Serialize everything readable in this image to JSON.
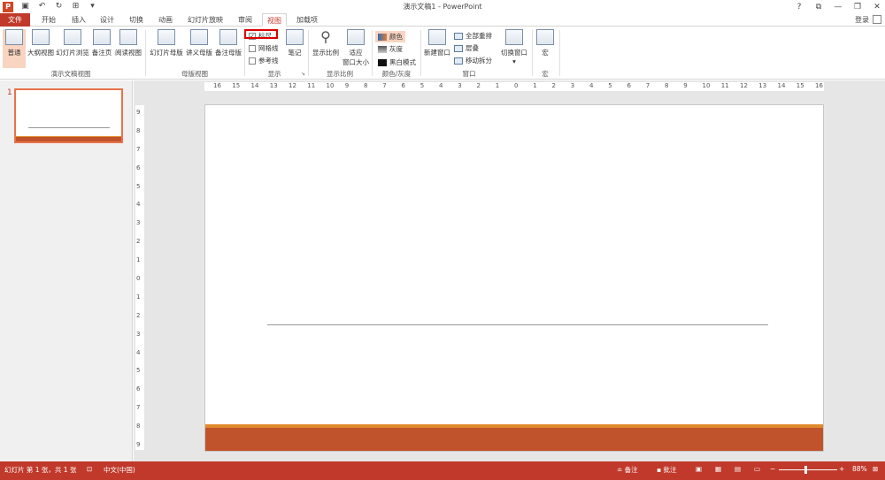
{
  "window": {
    "title": "演示文稿1 - PowerPoint",
    "logo": "P",
    "controls": [
      "?",
      "⧉",
      "—",
      "❐",
      "✕"
    ]
  },
  "quick_access": {
    "icons": [
      "save-icon",
      "undo-icon",
      "redo-icon",
      "start-from-beginning-icon",
      "customize-icon"
    ]
  },
  "tabs": [
    {
      "label": "文件"
    },
    {
      "label": "开始"
    },
    {
      "label": "插入"
    },
    {
      "label": "设计"
    },
    {
      "label": "切换"
    },
    {
      "label": "动画"
    },
    {
      "label": "幻灯片放映"
    },
    {
      "label": "审阅"
    },
    {
      "label": "视图"
    },
    {
      "label": "加载项"
    }
  ],
  "account": {
    "login": "登录"
  },
  "ribbon": {
    "groups": [
      {
        "label": "演示文稿视图",
        "buttons": [
          "普通",
          "大纲视图",
          "幻灯片浏览",
          "备注页",
          "阅读视图"
        ]
      },
      {
        "label": "母版视图",
        "buttons": [
          "幻灯片母版",
          "讲义母版",
          "备注母版"
        ]
      },
      {
        "label": "显示",
        "checkboxes": [
          "标尺",
          "网格线",
          "参考线"
        ],
        "button": "笔记"
      },
      {
        "label": "显示比例",
        "buttons": [
          "显示比例",
          "适应",
          "窗口大小"
        ]
      },
      {
        "label": "颜色/灰度",
        "options": [
          "颜色",
          "灰度",
          "黑白模式"
        ]
      },
      {
        "label": "窗口",
        "button": "新建窗口",
        "options": [
          "全部重排",
          "层叠",
          "移动拆分"
        ]
      },
      {
        "label": "",
        "button": "切换窗口"
      },
      {
        "label": "宏",
        "button": "宏"
      }
    ],
    "colors": {
      "selected": "#f9d4c0",
      "highlight": "#e00000"
    }
  },
  "slides_pane": {
    "number": "1"
  },
  "ruler": {
    "h_ticks": [
      "16",
      "15",
      "14",
      "13",
      "12",
      "11",
      "10",
      "9",
      "8",
      "7",
      "6",
      "5",
      "4",
      "3",
      "2",
      "1",
      "0",
      "1",
      "2",
      "3",
      "4",
      "5",
      "6",
      "7",
      "8",
      "9",
      "10",
      "11",
      "12",
      "13",
      "14",
      "15",
      "16"
    ],
    "v_ticks": [
      "9",
      "8",
      "7",
      "6",
      "5",
      "4",
      "3",
      "2",
      "1",
      "0",
      "1",
      "2",
      "3",
      "4",
      "5",
      "6",
      "7",
      "8",
      "9"
    ]
  },
  "statusbar": {
    "slide_info": "幻灯片 第 1 张，共 1 张",
    "language": "中文(中国)",
    "notes": "备注",
    "comments": "批注",
    "zoom": "88%",
    "zoom_level": 0.45,
    "colors": {
      "bar": "#c0392b"
    }
  }
}
